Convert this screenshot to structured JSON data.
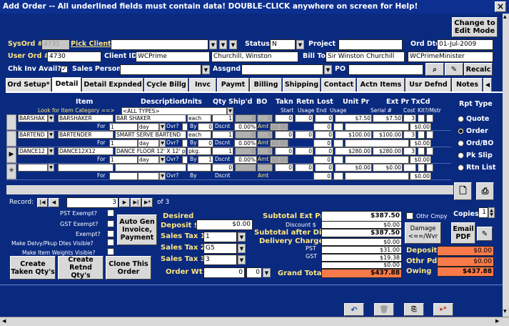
{
  "title": "Add Order -- All underlined fields must contain data!  DOUBLE-CLICK anywhere on screen for Help!",
  "close_glyph": "×",
  "change_btn": "Change to Edit Mode",
  "header": {
    "sysord_label": "SysOrd #",
    "sysord_value": "4731",
    "pick_client": "Pick Client",
    "status_label": "Status",
    "status_value": "N",
    "project_label": "Project",
    "ord_dte_label": "Ord Dte",
    "ord_dte_value": "01-Jul-2009",
    "user_ord_label": "User Ord #",
    "user_ord_value": "4730",
    "client_id_label": "Client ID",
    "client_id_value": "WCPrime",
    "client_name": "Churchill, Winston",
    "bill_to_label": "Bill To",
    "bill_to_value": "Sir Winston Churchill",
    "bill_to_extra": "WCPrimeMinister",
    "chk_inv_label": "Chk Inv Avail?",
    "sales_person_label": "Sales Person",
    "assgnd_label": "Assgnd",
    "po_label": "PO",
    "recalc": "Recalc"
  },
  "tabs": [
    "Ord Setup*",
    "Detail",
    "Detail Expnded",
    "Cycle Billg",
    "Invc",
    "Paymt",
    "Billing",
    "Shipping",
    "Contact",
    "Actn Items",
    "Usr Defnd",
    "Notes"
  ],
  "grid": {
    "headers": [
      "Item",
      "Description",
      "Units",
      "Qty",
      "Ship'd",
      "BO",
      "Takn",
      "Retn",
      "Lost",
      "Unit Pr",
      "Ext Pr",
      "TxCd"
    ],
    "subheaders": [
      "Start",
      "Usage",
      "End",
      "Usage",
      "Serial #",
      "Cost",
      "Kit?/Mstr"
    ],
    "look_for_label": "Look for Item Category ==>",
    "look_for_value": "<ALL TYPES>",
    "for_label": "For",
    "ovr_label": "Ovr?",
    "by_label": "By",
    "dscnt_label": "Dscnt",
    "amt_label": "Amt",
    "rows": [
      {
        "code": "BARSHAK",
        "item": "BARSHAKER",
        "desc": "BAR SHAKER",
        "units": "each",
        "qty": "1",
        "shipd": "0",
        "bo": "0",
        "takn": "0",
        "retn": "0",
        "lost": "0",
        "unit_pr": "$7.50",
        "ext_pr": "$7.50",
        "txcd": "3",
        "for_qty": "1",
        "period": "day",
        "by": "0",
        "dscnt": "0.00%",
        "amt": "$0.00",
        "serial": "0",
        "sub_total": "$0.00"
      },
      {
        "code": "BARTEND",
        "item": "BARTENDER",
        "desc": "SMART SERVE BARTEND",
        "units": "each",
        "qty": "1",
        "shipd": "0",
        "bo": "0",
        "takn": "0",
        "retn": "0",
        "lost": "0",
        "unit_pr": "$100.00",
        "ext_pr": "$100.00",
        "txcd": "3",
        "for_qty": "1",
        "period": "day",
        "by": "0",
        "dscnt": "0.00%",
        "amt": "$0.00",
        "serial": "0",
        "sub_total": "$0.00"
      },
      {
        "code": "DANCE12",
        "item": "DANCE12X12",
        "desc": "DANCE FLOOR 12' X 12' p",
        "units": "pkg.",
        "qty": "1",
        "shipd": "0",
        "bo": "0",
        "takn": "0",
        "retn": "0",
        "lost": "0",
        "unit_pr": "$280.00",
        "ext_pr": "$280.00",
        "txcd": "3",
        "for_qty": "1",
        "period": "day",
        "by": "1",
        "dscnt": "0.00%",
        "amt": "$0.00",
        "serial": "0",
        "sub_total": "$0.00"
      },
      {
        "code": "",
        "item": "",
        "desc": "",
        "units": "",
        "qty": "0",
        "shipd": "",
        "bo": "",
        "takn": "0",
        "retn": "0",
        "lost": "0",
        "unit_pr": "$0.00",
        "ext_pr": "$0.00",
        "txcd": "",
        "for_qty": "",
        "period": "",
        "by": "",
        "dscnt": "",
        "amt": "",
        "serial": "0",
        "sub_total": "$0.00"
      }
    ]
  },
  "side": {
    "rpt_type_label": "Rpt Type",
    "options": [
      "Quote",
      "Order",
      "Ord/BO",
      "Pk Slip",
      "Rtn List"
    ],
    "selected": "Order"
  },
  "record_nav": {
    "label": "Record:",
    "current": "3",
    "of": "of 3"
  },
  "exempt": {
    "pst": "PST Exempt?",
    "gst": "GST Exempt?",
    "exempt": "Exempt?",
    "delvy": "Make Delvy/Pkup Dtes Visible?",
    "weights": "Make Item Weights Visible?"
  },
  "buttons": {
    "auto_gen": "Auto Gen Invoice, Payment",
    "create_taken": "Create Taken Qty's",
    "create_retnd": "Create Retnd Qty's",
    "clone": "Clone This Order",
    "damage": "Damage <==/Wvr",
    "email_pdf": "Email PDF",
    "copies_label": "Copies",
    "copies_value": "1"
  },
  "deposit": {
    "desired_label": "Desired",
    "deposit_label": "Deposit $",
    "deposit_value": "$0.00",
    "sales_tax_1": "Sales Tax 1",
    "sales_tax_1_value": "1",
    "sales_tax_2": "Sales Tax 2",
    "sales_tax_2_value": "G5",
    "sales_tax_3": "Sales Tax 3",
    "sales_tax_3_value": "3",
    "order_wt_label": "Order Wt",
    "order_wt_value": "0",
    "order_wt_unit": "0"
  },
  "totals": {
    "subtotal_ext_label": "Subtotal Ext Price",
    "subtotal_ext_value": "$387.50",
    "discount_label": "Discount $",
    "discount_value": "$0.00",
    "subtotal_after_label": "Subtotal after Discnt",
    "subtotal_after_value": "$387.50",
    "delivery_label": "Delivery Charges",
    "delivery_value": "$0.00",
    "pst_label": "PST",
    "pst_value": "$31.00",
    "gst_label": "GST",
    "gst_value": "$19.38",
    "blank_value": "$0.00",
    "grand_total_label": "Grand Total",
    "grand_total_value": "$437.88",
    "othr_cmpy_label": "Othr Cmpy"
  },
  "payments": {
    "deposit_label": "Deposit",
    "deposit_value": "$0.00",
    "othr_pd_label": "Othr Pd",
    "othr_pd_value": "$0.00",
    "owing_label": "Owing",
    "owing_value": "$437.88"
  },
  "colors": {
    "background": "#0a2a80",
    "orange": "#f97a4a",
    "label_yellow": "#ffe680"
  }
}
